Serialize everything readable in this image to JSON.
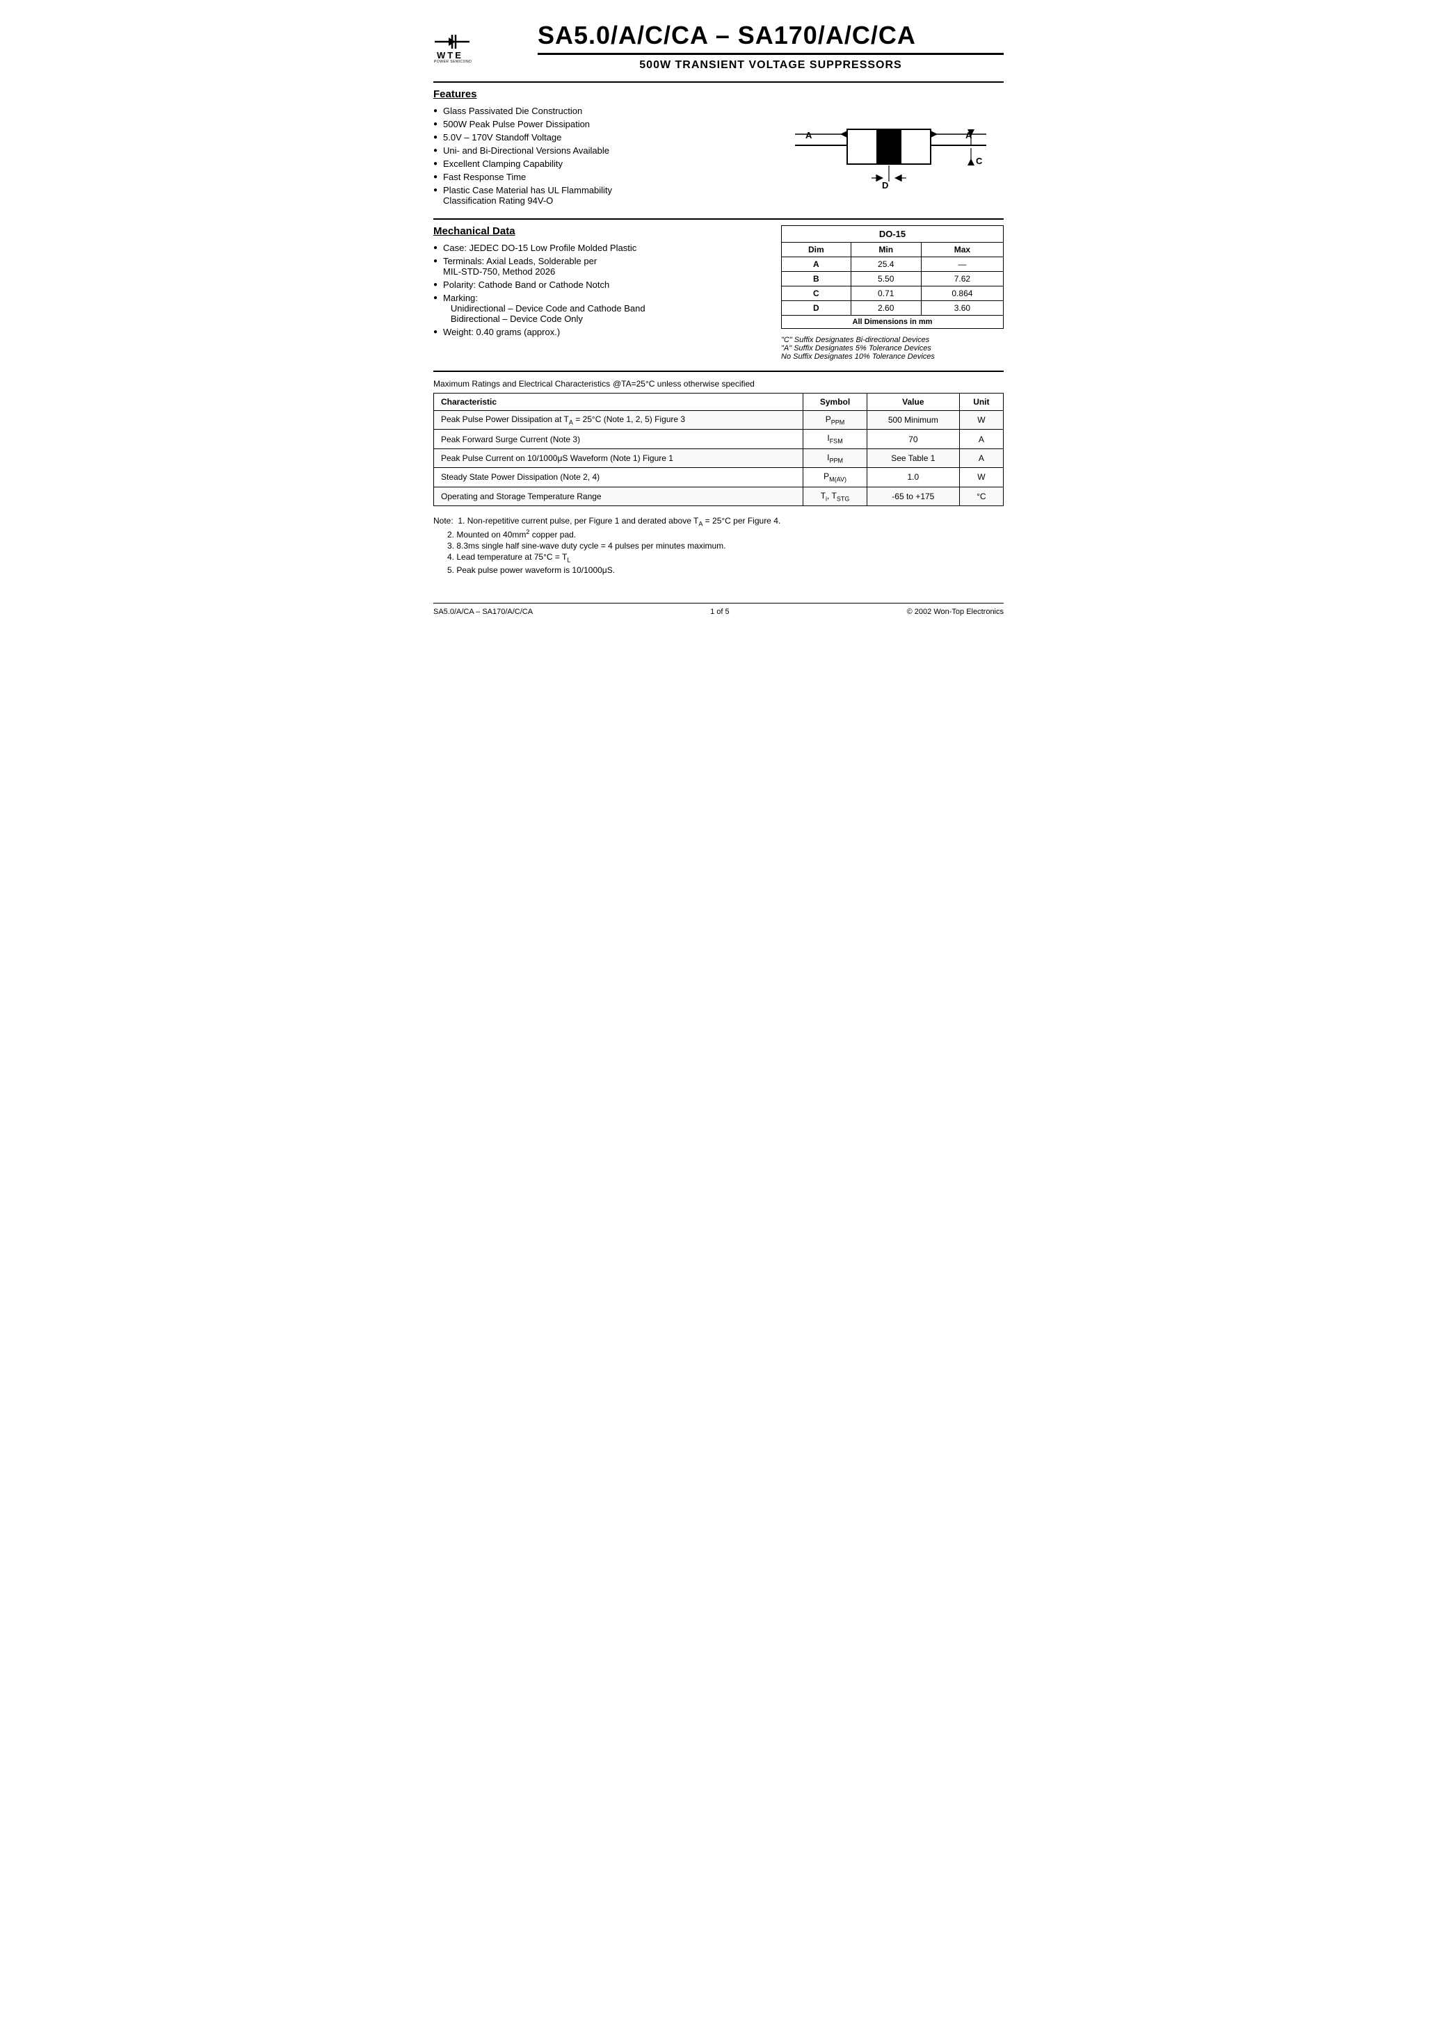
{
  "header": {
    "logo_arrow": "◄+",
    "logo_wte": "WTE",
    "logo_sub": "POWER SEMICONDUCTORS",
    "main_title": "SA5.0/A/C/CA – SA170/A/C/CA",
    "sub_title": "500W TRANSIENT VOLTAGE SUPPRESSORS"
  },
  "features": {
    "title": "Features",
    "items": [
      "Glass Passivated Die Construction",
      "500W Peak Pulse Power Dissipation",
      "5.0V – 170V Standoff Voltage",
      "Uni- and Bi-Directional Versions Available",
      "Excellent Clamping Capability",
      "Fast Response Time",
      "Plastic Case Material has UL Flammability Classification Rating 94V-O"
    ]
  },
  "mechanical": {
    "title": "Mechanical Data",
    "items": [
      "Case: JEDEC DO-15 Low Profile Molded Plastic",
      "Terminals: Axial Leads, Solderable per MIL-STD-750, Method 2026",
      "Polarity: Cathode Band or Cathode Notch",
      "Marking:",
      "Unidirectional – Device Code and Cathode Band",
      "Bidirectional – Device Code Only",
      "Weight: 0.40 grams (approx.)"
    ]
  },
  "do15_table": {
    "title": "DO-15",
    "headers": [
      "Dim",
      "Min",
      "Max"
    ],
    "rows": [
      {
        "dim": "A",
        "min": "25.4",
        "max": "—"
      },
      {
        "dim": "B",
        "min": "5.50",
        "max": "7.62"
      },
      {
        "dim": "C",
        "min": "0.71",
        "max": "0.864"
      },
      {
        "dim": "D",
        "min": "2.60",
        "max": "3.60"
      }
    ],
    "footer": "All Dimensions in mm"
  },
  "suffix_notes": [
    "\"C\" Suffix Designates Bi-directional Devices",
    "\"A\" Suffix Designates 5% Tolerance Devices",
    "No Suffix Designates 10% Tolerance Devices"
  ],
  "ratings": {
    "title": "Maximum Ratings and Electrical Characteristics",
    "condition": "@TA=25°C unless otherwise specified",
    "headers": [
      "Characteristic",
      "Symbol",
      "Value",
      "Unit"
    ],
    "rows": [
      {
        "char": "Peak Pulse Power Dissipation at TA = 25°C (Note 1, 2, 5) Figure 3",
        "symbol": "PPPM",
        "value": "500 Minimum",
        "unit": "W"
      },
      {
        "char": "Peak Forward Surge Current (Note 3)",
        "symbol": "IFSM",
        "value": "70",
        "unit": "A"
      },
      {
        "char": "Peak Pulse Current on 10/1000μS Waveform (Note 1) Figure 1",
        "symbol": "IPPM",
        "value": "See Table 1",
        "unit": "A"
      },
      {
        "char": "Steady State Power Dissipation (Note 2, 4)",
        "symbol": "PM(AV)",
        "value": "1.0",
        "unit": "W"
      },
      {
        "char": "Operating and Storage Temperature Range",
        "symbol": "Ti, TSTG",
        "value": "-65 to +175",
        "unit": "°C"
      }
    ]
  },
  "notes": {
    "intro": "Note:",
    "items": [
      "1. Non-repetitive current pulse, per Figure 1 and derated above TA = 25°C per Figure 4.",
      "2. Mounted on 40mm² copper pad.",
      "3. 8.3ms single half sine-wave duty cycle = 4 pulses per minutes maximum.",
      "4. Lead temperature at 75°C = TL",
      "5. Peak pulse power waveform is 10/1000μS."
    ]
  },
  "footer": {
    "left": "SA5.0/A/CA – SA170/A/C/CA",
    "center": "1 of 5",
    "right": "© 2002 Won-Top Electronics"
  }
}
